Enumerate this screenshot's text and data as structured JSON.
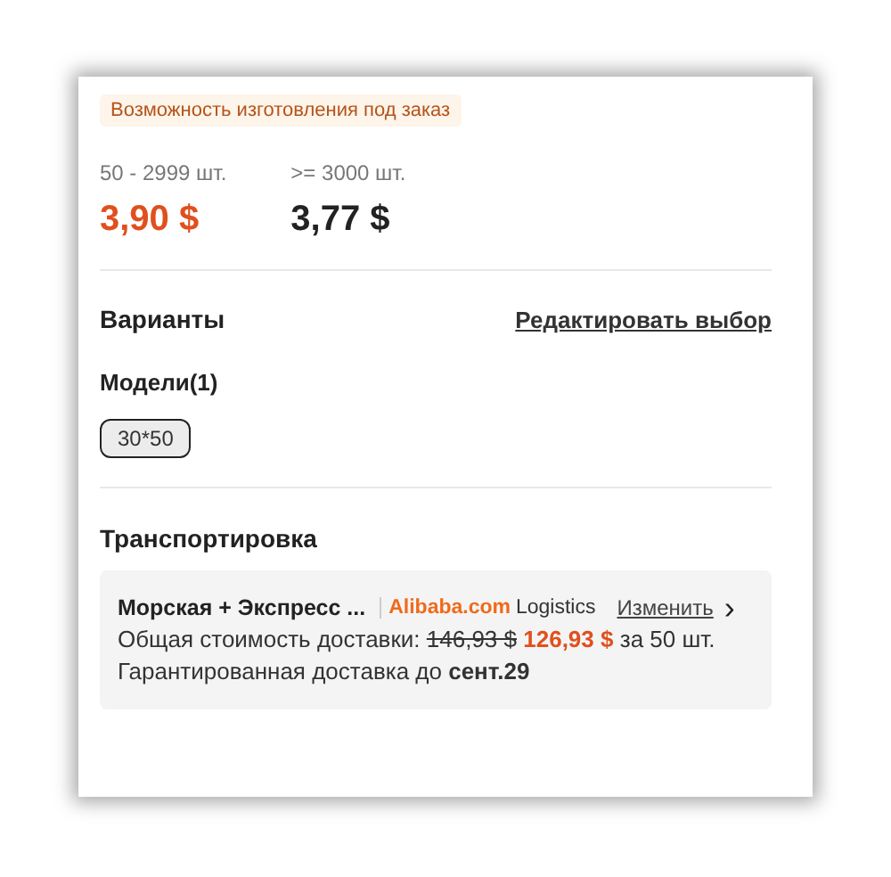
{
  "badge": "Возможность изготовления под заказ",
  "price_tiers": [
    {
      "range": "50 - 2999 шт.",
      "price": "3,90 $",
      "selected": true
    },
    {
      "range": ">= 3000 шт.",
      "price": "3,77 $",
      "selected": false
    }
  ],
  "variants": {
    "title": "Варианты",
    "edit_link": "Редактировать выбор",
    "group_label": "Модели(1)",
    "options": [
      {
        "label": "30*50",
        "selected": true
      }
    ]
  },
  "shipping": {
    "title": "Транспортировка",
    "method": "Морская + Экспресс ...",
    "carrier_brand": "Alibaba.com",
    "carrier_suffix": "Logistics",
    "change_link": "Изменить",
    "chevron": "›",
    "cost_label": "Общая стоимость доставки:",
    "old_price": "146,93 $",
    "new_price": "126,93 $",
    "cost_suffix": "за 50 шт.",
    "delivery": "Гарантированная доставка до **сент.29**"
  }
}
